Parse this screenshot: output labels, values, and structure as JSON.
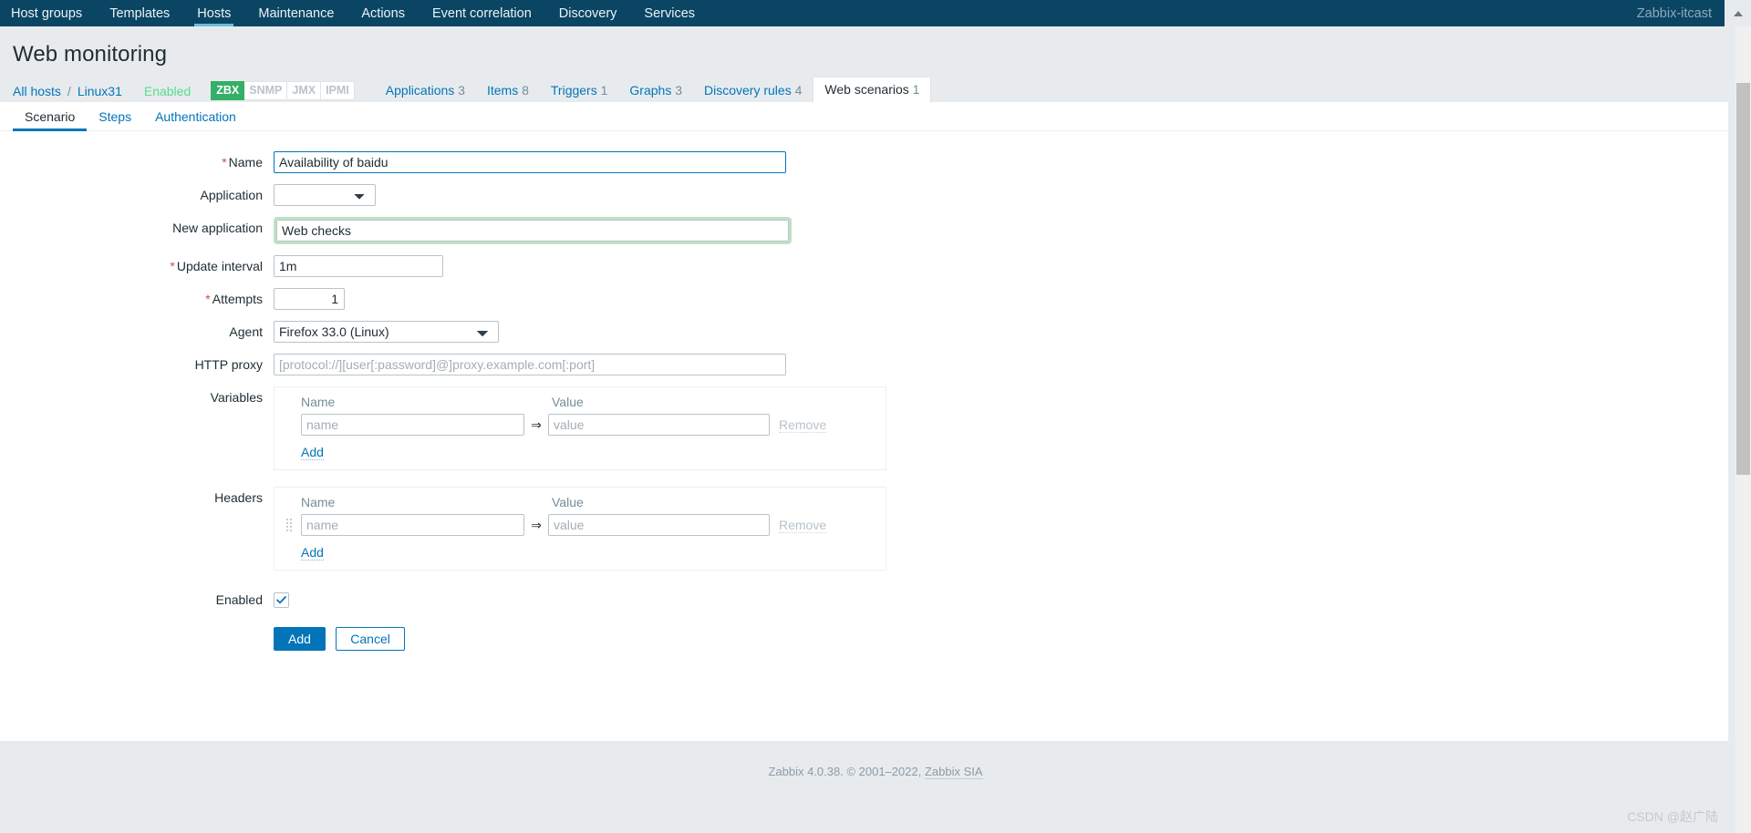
{
  "topnav": {
    "items": [
      {
        "label": "Host groups",
        "selected": false
      },
      {
        "label": "Templates",
        "selected": false
      },
      {
        "label": "Hosts",
        "selected": true
      },
      {
        "label": "Maintenance",
        "selected": false
      },
      {
        "label": "Actions",
        "selected": false
      },
      {
        "label": "Event correlation",
        "selected": false
      },
      {
        "label": "Discovery",
        "selected": false
      },
      {
        "label": "Services",
        "selected": false
      }
    ],
    "user": "Zabbix-itcast",
    "collapse_icon": "caret-up-icon"
  },
  "header": {
    "title": "Web monitoring"
  },
  "breadcrumb": {
    "all_hosts": "All hosts",
    "separator": "/",
    "host": "Linux31",
    "status": "Enabled",
    "interfaces": [
      {
        "label": "ZBX",
        "active": true
      },
      {
        "label": "SNMP",
        "active": false
      },
      {
        "label": "JMX",
        "active": false
      },
      {
        "label": "IPMI",
        "active": false
      }
    ],
    "tabs": [
      {
        "label": "Applications",
        "count": "3",
        "current": false
      },
      {
        "label": "Items",
        "count": "8",
        "current": false
      },
      {
        "label": "Triggers",
        "count": "1",
        "current": false
      },
      {
        "label": "Graphs",
        "count": "3",
        "current": false
      },
      {
        "label": "Discovery rules",
        "count": "4",
        "current": false
      },
      {
        "label": "Web scenarios",
        "count": "1",
        "current": true
      }
    ]
  },
  "form_tabs": [
    {
      "label": "Scenario",
      "active": true
    },
    {
      "label": "Steps",
      "active": false
    },
    {
      "label": "Authentication",
      "active": false
    }
  ],
  "form": {
    "name": {
      "label": "Name",
      "required": true,
      "value": "Availability of baidu"
    },
    "application": {
      "label": "Application",
      "required": false,
      "value": "",
      "options": [
        ""
      ]
    },
    "new_application": {
      "label": "New application",
      "required": false,
      "value": "Web checks"
    },
    "update_interval": {
      "label": "Update interval",
      "required": true,
      "value": "1m"
    },
    "attempts": {
      "label": "Attempts",
      "required": true,
      "value": "1"
    },
    "agent": {
      "label": "Agent",
      "required": false,
      "value": "Firefox 33.0 (Linux)",
      "options": [
        "Firefox 33.0 (Linux)"
      ]
    },
    "http_proxy": {
      "label": "HTTP proxy",
      "required": false,
      "value": "",
      "placeholder": "[protocol://][user[:password]@]proxy.example.com[:port]"
    },
    "variables": {
      "label": "Variables",
      "col_name": "Name",
      "col_value": "Value",
      "rows": [
        {
          "name": "",
          "name_placeholder": "name",
          "value": "",
          "value_placeholder": "value",
          "arrow": "⇒",
          "remove_label": "Remove"
        }
      ],
      "add_label": "Add"
    },
    "headers": {
      "label": "Headers",
      "col_name": "Name",
      "col_value": "Value",
      "rows": [
        {
          "name": "",
          "name_placeholder": "name",
          "value": "",
          "value_placeholder": "value",
          "arrow": "⇒",
          "remove_label": "Remove"
        }
      ],
      "add_label": "Add"
    },
    "enabled": {
      "label": "Enabled",
      "checked": true
    },
    "buttons": {
      "submit": "Add",
      "cancel": "Cancel"
    }
  },
  "footer": {
    "text": "Zabbix 4.0.38. © 2001–2022, ",
    "link": "Zabbix SIA"
  },
  "watermark": "CSDN @赵广陆",
  "colors": {
    "nav_bg": "#0a4664",
    "accent": "#0275b8",
    "page_bg": "#e8ebee",
    "status_green": "#59db8f",
    "iface_active": "#34af67",
    "required_red": "#d34d4d",
    "focus_green_glow": "#bfe2c4"
  }
}
